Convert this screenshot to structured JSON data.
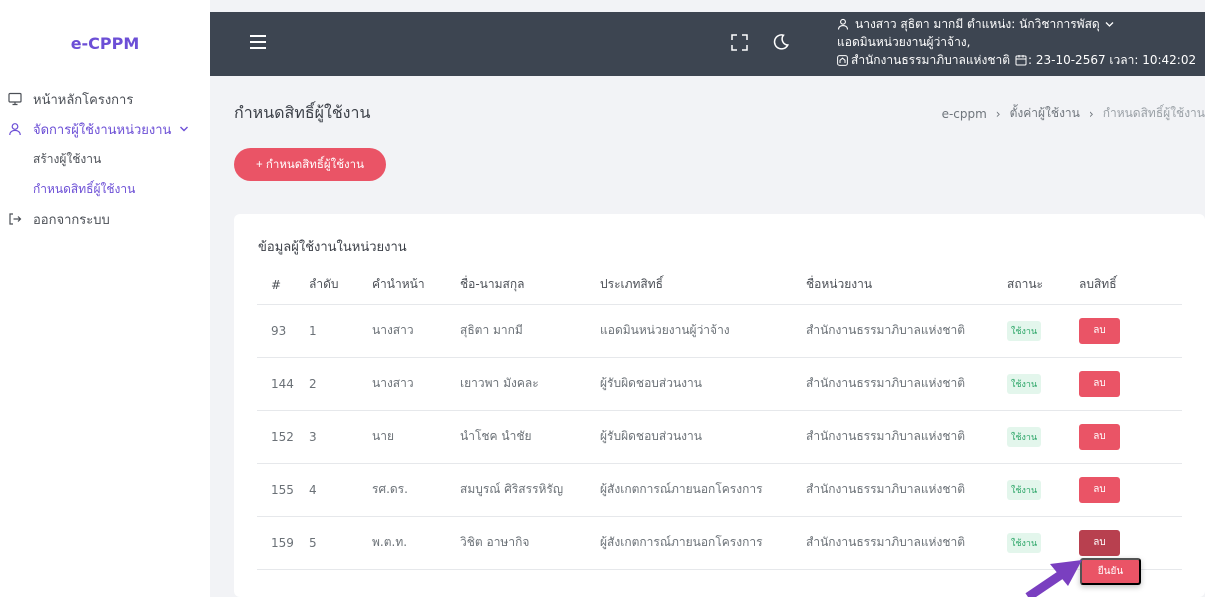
{
  "app": {
    "logo": "e-CPPM"
  },
  "sidebar": {
    "items": [
      {
        "label": "หน้าหลักโครงการ",
        "icon": "monitor-icon"
      },
      {
        "label": "จัดการผู้ใช้งานหน่วยงาน",
        "icon": "user-icon",
        "expanded": true
      },
      {
        "label": "สร้างผู้ใช้งาน"
      },
      {
        "label": "กำหนดสิทธิ์ผู้ใช้งาน"
      },
      {
        "label": "ออกจากระบบ",
        "icon": "logout-icon"
      }
    ]
  },
  "header": {
    "user_line": "นางสาว สุธิตา มากมี ตำแหน่ง: นักวิชาการพัสดุ",
    "role_line": "แอดมินหน่วยงานผู้ว่าจ้าง,",
    "org_line": "สำนักงานธรรมาภิบาลแห่งชาติ",
    "date_line": ": 23-10-2567 เวลา: 10:42:02"
  },
  "page": {
    "title": "กำหนดสิทธิ์ผู้ใช้งาน",
    "breadcrumb": [
      "e-cppm",
      "ตั้งค่าผู้ใช้งาน",
      "กำหนดสิทธิ์ผู้ใช้งาน"
    ],
    "add_button": "+ กำหนดสิทธิ์ผู้ใช้งาน"
  },
  "table": {
    "title": "ข้อมูลผู้ใช้งานในหน่วยงาน",
    "columns": [
      "#",
      "ลำดับ",
      "คำนำหน้า",
      "ชื่อ-นามสกุล",
      "ประเภทสิทธิ์",
      "ชื่อหน่วยงาน",
      "สถานะ",
      "ลบสิทธิ์"
    ],
    "rows": [
      {
        "id": "93",
        "seq": "1",
        "prefix": "นางสาว",
        "name": "สุธิตา มากมี",
        "role": "แอดมินหน่วยงานผู้ว่าจ้าง",
        "org": "สำนักงานธรรมาภิบาลแห่งชาติ",
        "status": "ใช้งาน",
        "delete": "ลบ"
      },
      {
        "id": "144",
        "seq": "2",
        "prefix": "นางสาว",
        "name": "เยาวพา มังคละ",
        "role": "ผู้รับผิดชอบส่วนงาน",
        "org": "สำนักงานธรรมาภิบาลแห่งชาติ",
        "status": "ใช้งาน",
        "delete": "ลบ"
      },
      {
        "id": "152",
        "seq": "3",
        "prefix": "นาย",
        "name": "นำโชค นำชัย",
        "role": "ผู้รับผิดชอบส่วนงาน",
        "org": "สำนักงานธรรมาภิบาลแห่งชาติ",
        "status": "ใช้งาน",
        "delete": "ลบ"
      },
      {
        "id": "155",
        "seq": "4",
        "prefix": "รศ.ดร.",
        "name": "สมบูรณ์ ศิริสรรหิรัญ",
        "role": "ผู้สังเกตการณ์ภายนอกโครงการ",
        "org": "สำนักงานธรรมาภิบาลแห่งชาติ",
        "status": "ใช้งาน",
        "delete": "ลบ"
      },
      {
        "id": "159",
        "seq": "5",
        "prefix": "พ.ต.ท.",
        "name": "วิชิต อาษากิจ",
        "role": "ผู้สังเกตการณ์ภายนอกโครงการ",
        "org": "สำนักงานธรรมาภิบาลแห่งชาติ",
        "status": "ใช้งาน",
        "delete": "ลบ"
      }
    ],
    "confirm_label": "ยืนยัน"
  },
  "colors": {
    "accent": "#6c4fd6",
    "danger": "#ea5466",
    "topbar": "#3d4551",
    "success": "#28a465",
    "annotation_arrow": "#7a3fc0"
  }
}
